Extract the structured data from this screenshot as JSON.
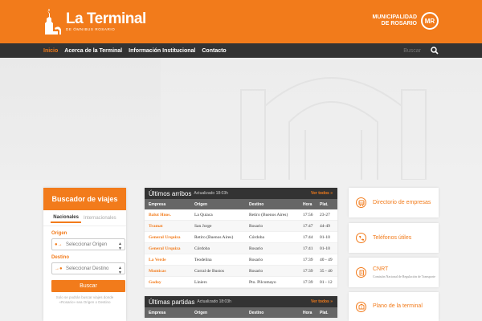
{
  "header": {
    "logo_title": "La Terminal",
    "logo_sub": "DE ÓMNIBUS ROSARIO",
    "muni_line1": "MUNICIPALIDAD",
    "muni_line2": "DE ROSARIO",
    "muni_badge": "MR"
  },
  "nav": {
    "items": [
      "Inicio",
      "Acerca de la Terminal",
      "Información Institucional",
      "Contacto"
    ],
    "search_placeholder": "Buscar"
  },
  "search": {
    "title": "Buscador de viajes",
    "tabs": [
      "Nacionales",
      "Internacionales"
    ],
    "origin_label": "Origen",
    "origin_placeholder": "Seleccionar Origen",
    "dest_label": "Destino",
    "dest_placeholder": "Seleccionar Destino",
    "button": "Buscar",
    "note": "Solo se podrán buscar viajes donde «Rosario» sea Origen o Destino"
  },
  "arrivals": {
    "title": "Últimos arribos",
    "updated": "Actualizado 18:03h",
    "ver_todos": "Ver todos »",
    "columns": [
      "Empresa",
      "Origen",
      "Destino",
      "Hora",
      "Plat."
    ],
    "rows": [
      [
        "Balut Hnos.",
        "La Quiaca",
        "Retiro (Buenos Aires)",
        "17:56",
        "23-27"
      ],
      [
        "Tramat",
        "San Jorge",
        "Rosario",
        "17:47",
        "44-49"
      ],
      [
        "General Urquiza",
        "Retiro (Buenos Aires)",
        "Córdoba",
        "17:44",
        "01-10"
      ],
      [
        "General Urquiza",
        "Córdoba",
        "Rosario",
        "17:41",
        "01-10"
      ],
      [
        "La Verde",
        "Teodelina",
        "Rosario",
        "17:39",
        "40 - 49"
      ],
      [
        "Monticas",
        "Corral de Bustos",
        "Rosario",
        "17:39",
        "35 - 40"
      ],
      [
        "Godoy",
        "Liniers",
        "Pto. Pilcomayo",
        "17:39",
        "01 - 12"
      ]
    ]
  },
  "departures": {
    "title": "Últimas partidas",
    "updated": "Actualizado 18:03h",
    "ver_todos": "Ver todos »",
    "columns": [
      "Empresa",
      "Origen",
      "Destino",
      "Hora",
      "Plat."
    ]
  },
  "side": [
    {
      "label": "Directorio de empresas",
      "icon": "bus-icon"
    },
    {
      "label": "Teléfonos útiles",
      "icon": "phone-icon"
    },
    {
      "label": "CNRT",
      "sub": "Comisión Nacional de Regulación de Transporte",
      "icon": "document-icon"
    },
    {
      "label": "Plano de la terminal",
      "icon": "map-icon"
    }
  ],
  "colors": {
    "accent": "#f27b1b",
    "dark": "#333333"
  }
}
